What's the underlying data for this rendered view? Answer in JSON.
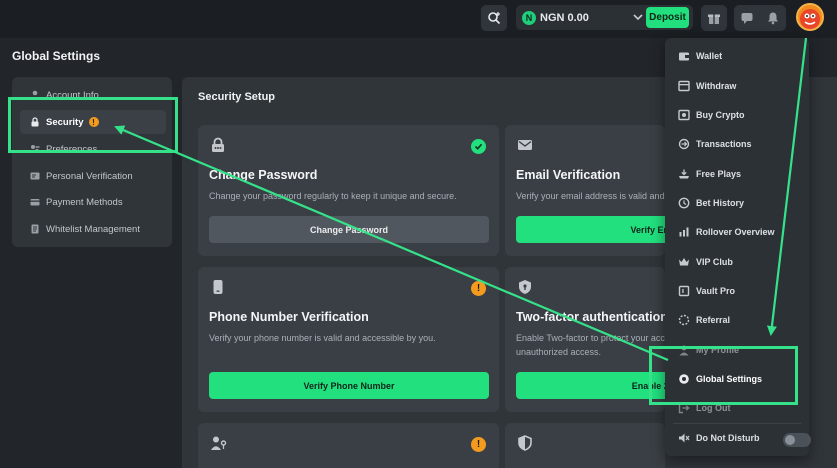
{
  "header": {
    "currency": "NGN",
    "balance": "0.00",
    "deposit_label": "Deposit"
  },
  "page": {
    "title": "Global Settings"
  },
  "sidebar": {
    "items": [
      {
        "label": "Account Info"
      },
      {
        "label": "Security",
        "badge": "!"
      },
      {
        "label": "Preferences"
      },
      {
        "label": "Personal Verification"
      },
      {
        "label": "Payment Methods"
      },
      {
        "label": "Whitelist Management"
      }
    ]
  },
  "security": {
    "section_title": "Security Setup",
    "cards": [
      {
        "title": "Change Password",
        "desc": "Change your password regularly to keep it unique and secure.",
        "button": "Change Password",
        "status": "done"
      },
      {
        "title": "Email Verification",
        "desc": "Verify your email address is valid and accessible by you.",
        "button": "Verify Email",
        "status": "pending"
      },
      {
        "title": "Phone Number Verification",
        "desc": "Verify your phone number is valid and accessible by you.",
        "button": "Verify Phone Number",
        "status": "warning"
      },
      {
        "title": "Two-factor authentication",
        "desc": "Enable Two-factor to protect your account from unauthorized access.",
        "button": "Enable 2FA",
        "status": "pending"
      },
      {
        "title": "",
        "status": "warning"
      },
      {
        "title": "",
        "status": "pending"
      }
    ]
  },
  "menu": {
    "items": [
      {
        "label": "Wallet",
        "icon": "wallet-icon"
      },
      {
        "label": "Withdraw",
        "icon": "withdraw-icon"
      },
      {
        "label": "Buy Crypto",
        "icon": "buy-crypto-icon"
      },
      {
        "label": "Transactions",
        "icon": "transactions-icon"
      },
      {
        "label": "Free Plays",
        "icon": "free-plays-icon"
      },
      {
        "label": "Bet History",
        "icon": "clock-icon"
      },
      {
        "label": "Rollover Overview",
        "icon": "rollover-icon"
      },
      {
        "label": "VIP Club",
        "icon": "crown-icon"
      },
      {
        "label": "Vault Pro",
        "icon": "vault-icon"
      },
      {
        "label": "Referral",
        "icon": "referral-icon"
      },
      {
        "label": "My Profile",
        "icon": "profile-icon"
      },
      {
        "label": "Global Settings",
        "icon": "settings-icon"
      },
      {
        "label": "Log Out",
        "icon": "logout-icon"
      }
    ],
    "dnd_label": "Do Not Disturb"
  },
  "colors": {
    "accent": "#22e07e",
    "warning": "#f39b1f",
    "annotation": "#35e28a"
  }
}
